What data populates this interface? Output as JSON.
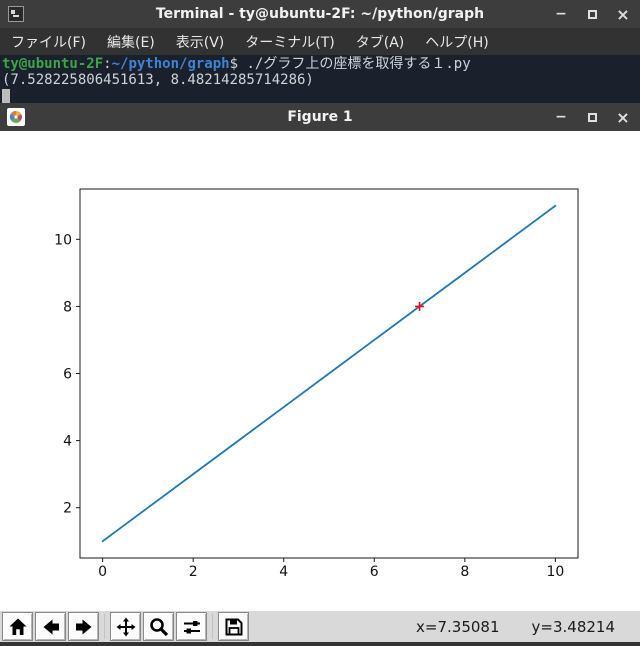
{
  "terminal_window": {
    "title": "Terminal - ty@ubuntu-2F: ~/python/graph",
    "menu": [
      "ファイル(F)",
      "編集(E)",
      "表示(V)",
      "ターミナル(T)",
      "タブ(A)",
      "ヘルプ(H)"
    ],
    "prompt": {
      "user_host": "ty@ubuntu-2F",
      "separator": ":",
      "path": "~/python/graph",
      "dollar": "$"
    },
    "command": "./グラフ上の座標を取得する１.py",
    "output": "(7.528225806451613, 8.48214285714286)",
    "controls": {
      "minimize": "−",
      "close": "×"
    }
  },
  "figure_window": {
    "title": "Figure 1",
    "controls": {
      "minimize": "−",
      "close": "×"
    },
    "toolbar": {
      "buttons": [
        "home-icon",
        "back-icon",
        "forward-icon",
        "pan-icon",
        "zoom-icon",
        "configure-subplots-icon",
        "save-icon"
      ],
      "status_x": "x=7.35081",
      "status_y": "y=3.48214"
    }
  },
  "chart_data": {
    "type": "line",
    "x": [
      0,
      1,
      2,
      3,
      4,
      5,
      6,
      7,
      8,
      9,
      10
    ],
    "y": [
      1,
      2,
      3,
      4,
      5,
      6,
      7,
      8,
      9,
      10,
      11
    ],
    "marker": {
      "x": 7,
      "y": 8,
      "symbol": "plus",
      "color": "#ff0000"
    },
    "xticks": [
      0,
      2,
      4,
      6,
      8,
      10
    ],
    "yticks": [
      2,
      4,
      6,
      8,
      10
    ],
    "xlim": [
      -0.5,
      10.5
    ],
    "ylim": [
      0.5,
      11.5
    ],
    "title": "",
    "xlabel": "",
    "ylabel": "",
    "grid": false,
    "legend": "none",
    "line_color": "#1f77b4"
  },
  "colors": {
    "titlebar_bg": "#3d3d3d",
    "menubar_bg": "#323232",
    "terminal_bg": "#1b212c",
    "prompt_green": "#3ea44a",
    "prompt_blue": "#3f83d6",
    "toolbar_bg": "#d9d9d9",
    "line_blue": "#1f77b4",
    "marker_red": "#ff0000"
  }
}
